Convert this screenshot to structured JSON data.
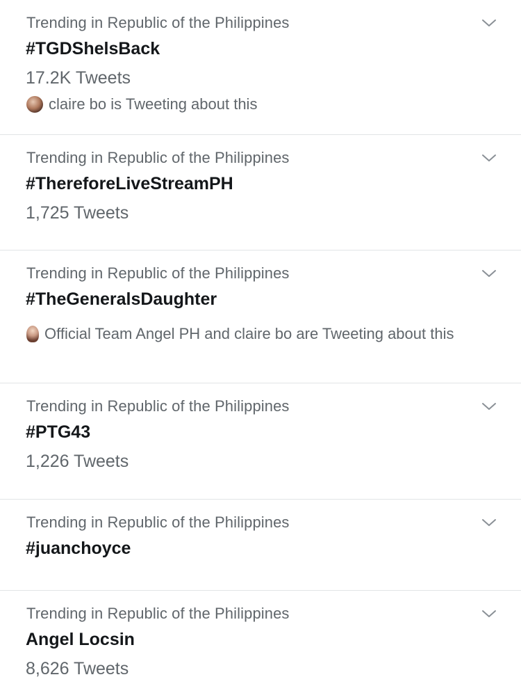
{
  "trends": [
    {
      "context": "Trending in Republic of the Philippines",
      "title": "#TGDShelsBack",
      "meta": "17.2K Tweets",
      "social": "claire bo is Tweeting about this"
    },
    {
      "context": "Trending in Republic of the Philippines",
      "title": "#ThereforeLiveStreamPH",
      "meta": "1,725 Tweets",
      "social": ""
    },
    {
      "context": "Trending in Republic of the Philippines",
      "title": "#TheGeneralsDaughter",
      "meta": "",
      "social": "Official Team Angel PH and claire bo are Tweeting about this"
    },
    {
      "context": "Trending in Republic of the Philippines",
      "title": "#PTG43",
      "meta": "1,226 Tweets",
      "social": ""
    },
    {
      "context": "Trending in Republic of the Philippines",
      "title": "#juanchoyce",
      "meta": "",
      "social": ""
    },
    {
      "context": "Trending in Republic of the Philippines",
      "title": "Angel Locsin",
      "meta": "8,626 Tweets",
      "social": ""
    }
  ],
  "colors": {
    "primary_text": "#14171a",
    "secondary_text": "#60666b",
    "divider": "#e1e4e6",
    "chevron": "#8a9096"
  },
  "icons": {
    "chevron": "chevron-down-icon",
    "avatar": "avatar"
  }
}
